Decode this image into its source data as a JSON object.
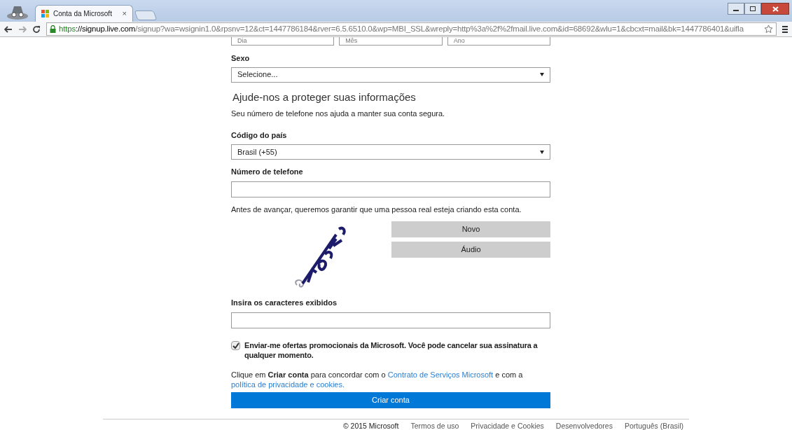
{
  "browser": {
    "tabs": [
      {
        "title": "Conta da Microsoft",
        "selected": true,
        "close": "×"
      }
    ],
    "address": {
      "scheme": "https",
      "host": "://signup.live.com",
      "path": "/signup?wa=wsignin1.0&rpsnv=12&ct=1447786184&rver=6.5.6510.0&wp=MBI_SSL&wreply=http%3a%2f%2fmail.live.com&id=68692&wlu=1&cbcxt=mail&bk=1447786401&uifla"
    }
  },
  "form": {
    "birth_selects": [
      "Dia",
      "Mês",
      "Ano"
    ],
    "gender": {
      "label": "Sexo",
      "value": "Selecione..."
    },
    "section_title": "Ajude-nos a proteger suas informações",
    "section_note": "Seu número de telefone nos ajuda a manter sua conta segura.",
    "country": {
      "label": "Código do país",
      "value": "Brasil (+55)"
    },
    "phone": {
      "label": "Número de telefone"
    },
    "captcha_prompt": "Antes de avançar, queremos garantir que uma pessoa real esteja criando esta conta.",
    "captcha_buttons": [
      "Novo",
      "Áudio"
    ],
    "captcha_field": {
      "label": "Insira os caracteres exibidos"
    },
    "promo": {
      "text": "Enviar-me ofertas promocionais da Microsoft. Você pode cancelar sua assinatura a qualquer momento.",
      "checked": true
    },
    "legal": [
      {
        "kind": "text",
        "text": "Clique em **Criar conta** para concordar com o"
      },
      {
        "kind": "link",
        "text": "Contrato de Serviços Microsoft"
      },
      {
        "kind": "text",
        "text": "e com a"
      },
      {
        "kind": "link",
        "text": "política de privacidade e cookies."
      }
    ],
    "submit": "Criar conta"
  },
  "footer": {
    "copyright": "© 2015 Microsoft",
    "links": [
      "Termos de uso",
      "Privacidade e Cookies",
      "Desenvolvedores",
      "Português (Brasil)"
    ]
  }
}
